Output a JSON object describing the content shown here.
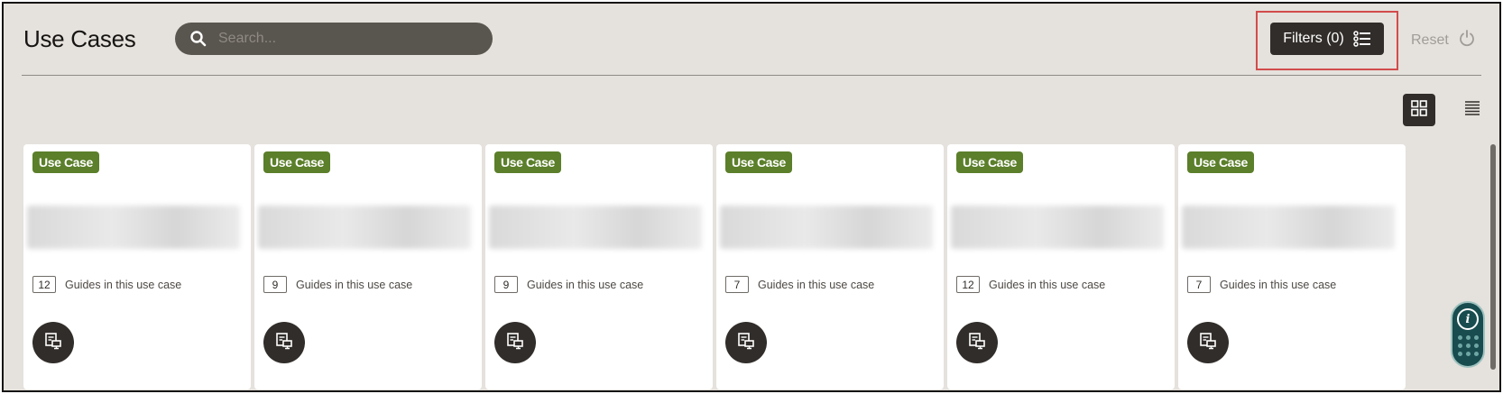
{
  "header": {
    "title": "Use Cases",
    "search_placeholder": "Search...",
    "filters_label": "Filters (0)",
    "reset_label": "Reset"
  },
  "view_toggle": {
    "active": "grid",
    "grid_icon": "grid-view-icon",
    "list_icon": "list-view-icon"
  },
  "cards": [
    {
      "badge": "Use Case",
      "guide_count": "12",
      "guides_text": "Guides in this use case",
      "action_icon": "presentation-icon"
    },
    {
      "badge": "Use Case",
      "guide_count": "9",
      "guides_text": "Guides in this use case",
      "action_icon": "presentation-icon"
    },
    {
      "badge": "Use Case",
      "guide_count": "9",
      "guides_text": "Guides in this use case",
      "action_icon": "presentation-icon"
    },
    {
      "badge": "Use Case",
      "guide_count": "7",
      "guides_text": "Guides in this use case",
      "action_icon": "presentation-icon"
    },
    {
      "badge": "Use Case",
      "guide_count": "12",
      "guides_text": "Guides in this use case",
      "action_icon": "presentation-icon"
    },
    {
      "badge": "Use Case",
      "guide_count": "7",
      "guides_text": "Guides in this use case",
      "action_icon": "presentation-icon"
    }
  ],
  "colors": {
    "background": "#e5e1dc",
    "dark": "#312d2a",
    "badge_green": "#5b7f2a",
    "highlight_red": "#d24c4c",
    "assistant_teal": "#184c4f"
  }
}
